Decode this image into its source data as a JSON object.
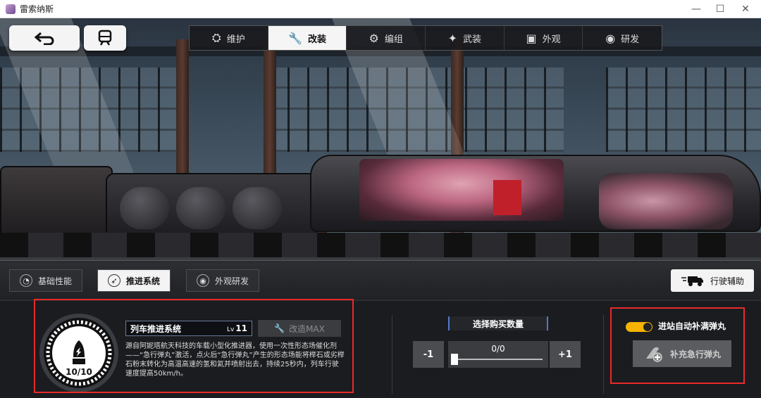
{
  "window": {
    "title": "雷索纳斯",
    "minimize": "—",
    "maximize": "☐",
    "close": "✕"
  },
  "top_buttons": {
    "back_icon": "back-arrow-icon",
    "train_icon": "train-icon"
  },
  "tabs": [
    {
      "label": "维护",
      "icon": "maintenance-icon",
      "glyph": "⛭",
      "active": false
    },
    {
      "label": "改装",
      "icon": "wrench-icon",
      "glyph": "🔧",
      "active": true
    },
    {
      "label": "编组",
      "icon": "gear-icon",
      "glyph": "⚙",
      "active": false
    },
    {
      "label": "武装",
      "icon": "weapon-icon",
      "glyph": "✦",
      "active": false
    },
    {
      "label": "外观",
      "icon": "appearance-icon",
      "glyph": "▣",
      "active": false
    },
    {
      "label": "研发",
      "icon": "research-icon",
      "glyph": "◉",
      "active": false
    }
  ],
  "subtabs": [
    {
      "label": "基础性能",
      "icon": "gauge-icon",
      "glyph": "◔",
      "active": false
    },
    {
      "label": "推进系统",
      "icon": "rocket-icon",
      "glyph": "➶",
      "active": true
    },
    {
      "label": "外观研发",
      "icon": "research-icon",
      "glyph": "◉",
      "active": false
    }
  ],
  "assist": {
    "label": "行驶辅助",
    "icon": "truck-icon"
  },
  "system": {
    "name": "列车推进系统",
    "lv_prefix": "Lv",
    "lv_value": "11",
    "mod_label": "改造MAX",
    "gauge_count": "10/10",
    "gauge_fraction": 1.0,
    "description": "源自阿妮塔航天科技的车载小型化推进器，使用一次性形态场催化剂——“急行弹丸”激活，点火后“急行弹丸”产生的形态场能将榉石或劣榉石粉末转化为高温高速的氢和氦并喷射出去，持续25秒内，列车行驶速度提高50km/h。"
  },
  "purchase": {
    "title": "选择购买数量",
    "minus": "-1",
    "plus": "+1",
    "value": "0/0",
    "fill_fraction": 0
  },
  "refill": {
    "toggle_label": "进站自动补满弹丸",
    "toggle_on": true,
    "button_label": "补充急行弹丸"
  },
  "colors": {
    "highlight": "#e82a2a",
    "accent": "#f5b400",
    "active_tab": "#f5f5f5"
  }
}
